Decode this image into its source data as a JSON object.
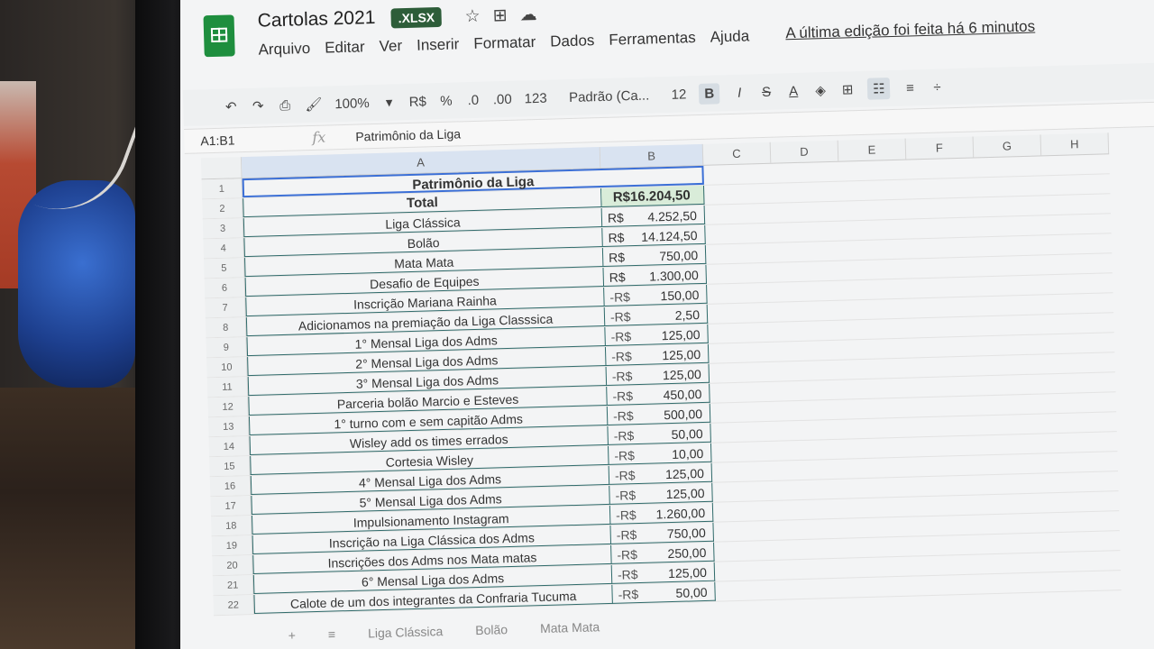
{
  "header": {
    "title": "Cartolas 2021",
    "badge": ".XLSX",
    "menu": [
      "Arquivo",
      "Editar",
      "Ver",
      "Inserir",
      "Formatar",
      "Dados",
      "Ferramentas",
      "Ajuda"
    ],
    "last_edit": "A última edição foi feita há 6 minutos"
  },
  "toolbar": {
    "zoom": "100%",
    "currency": "R$",
    "percent": "%",
    "dec_less": ".0",
    "dec_more": ".00",
    "format_more": "123",
    "font": "Padrão (Ca...",
    "font_size": "12"
  },
  "formula_bar": {
    "range": "A1:B1",
    "content": "Patrimônio da Liga"
  },
  "columns": [
    "A",
    "B",
    "C",
    "D",
    "E",
    "F",
    "G",
    "H"
  ],
  "sheet": {
    "title": "Patrimônio da Liga",
    "total_label": "Total",
    "total_value": "R$16.204,50",
    "rows": [
      {
        "num": "3",
        "label": "Liga Clássica",
        "prefix": "R$",
        "value": "4.252,50"
      },
      {
        "num": "4",
        "label": "Bolão",
        "prefix": "R$",
        "value": "14.124,50"
      },
      {
        "num": "5",
        "label": "Mata Mata",
        "prefix": "R$",
        "value": "750,00"
      },
      {
        "num": "6",
        "label": "Desafio de Equipes",
        "prefix": "R$",
        "value": "1.300,00"
      },
      {
        "num": "7",
        "label": "Inscrição Mariana Rainha",
        "prefix": "-R$",
        "value": "150,00"
      },
      {
        "num": "8",
        "label": "Adicionamos na premiação da Liga Classsica",
        "prefix": "-R$",
        "value": "2,50"
      },
      {
        "num": "9",
        "label": "1° Mensal Liga dos Adms",
        "prefix": "-R$",
        "value": "125,00"
      },
      {
        "num": "10",
        "label": "2° Mensal Liga dos Adms",
        "prefix": "-R$",
        "value": "125,00"
      },
      {
        "num": "11",
        "label": "3° Mensal Liga dos Adms",
        "prefix": "-R$",
        "value": "125,00"
      },
      {
        "num": "12",
        "label": "Parceria bolão Marcio e Esteves",
        "prefix": "-R$",
        "value": "450,00"
      },
      {
        "num": "13",
        "label": "1° turno com e sem capitão Adms",
        "prefix": "-R$",
        "value": "500,00"
      },
      {
        "num": "14",
        "label": "Wisley add os times errados",
        "prefix": "-R$",
        "value": "50,00"
      },
      {
        "num": "15",
        "label": "Cortesia Wisley",
        "prefix": "-R$",
        "value": "10,00"
      },
      {
        "num": "16",
        "label": "4° Mensal Liga dos Adms",
        "prefix": "-R$",
        "value": "125,00"
      },
      {
        "num": "17",
        "label": "5° Mensal Liga dos Adms",
        "prefix": "-R$",
        "value": "125,00"
      },
      {
        "num": "18",
        "label": "Impulsionamento Instagram",
        "prefix": "-R$",
        "value": "1.260,00"
      },
      {
        "num": "19",
        "label": "Inscrição na Liga Clássica dos Adms",
        "prefix": "-R$",
        "value": "750,00"
      },
      {
        "num": "20",
        "label": "Inscrições dos Adms nos Mata matas",
        "prefix": "-R$",
        "value": "250,00"
      },
      {
        "num": "21",
        "label": "6° Mensal Liga dos Adms",
        "prefix": "-R$",
        "value": "125,00"
      },
      {
        "num": "22",
        "label": "Calote de um dos integrantes da Confraria Tucuma",
        "prefix": "-R$",
        "value": "50,00"
      }
    ]
  },
  "tabs": [
    "Liga Clássica",
    "Bolão",
    "Mata Mata"
  ],
  "colors": {
    "brand": "#1e8e3e",
    "xlsx_badge": "#2d5d39",
    "total_fill": "#d9ecd9",
    "selection": "#3b6fd6"
  }
}
